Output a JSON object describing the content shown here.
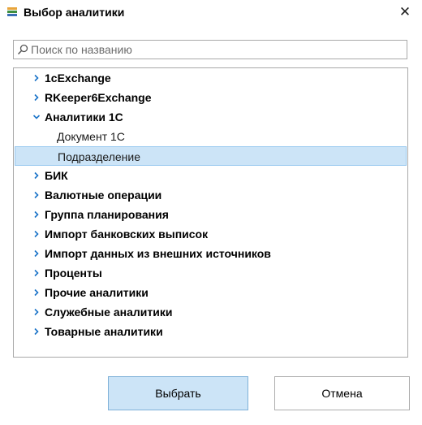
{
  "window": {
    "title": "Выбор аналитики",
    "close_glyph": "✕"
  },
  "search": {
    "placeholder": "Поиск по названию",
    "value": ""
  },
  "tree": {
    "items": [
      {
        "label": "1cExchange",
        "expanded": false
      },
      {
        "label": "RKeeper6Exchange",
        "expanded": false
      },
      {
        "label": "Аналитики 1С",
        "expanded": true,
        "children": [
          {
            "label": "Документ 1С",
            "selected": false
          },
          {
            "label": "Подразделение",
            "selected": true
          }
        ]
      },
      {
        "label": "БИК",
        "expanded": false
      },
      {
        "label": "Валютные операции",
        "expanded": false
      },
      {
        "label": "Группа планирования",
        "expanded": false
      },
      {
        "label": "Импорт банковских выписок",
        "expanded": false
      },
      {
        "label": "Импорт данных из внешних источников",
        "expanded": false
      },
      {
        "label": "Проценты",
        "expanded": false
      },
      {
        "label": "Прочие аналитики",
        "expanded": false
      },
      {
        "label": "Служебные аналитики",
        "expanded": false
      },
      {
        "label": "Товарные аналитики",
        "expanded": false
      }
    ]
  },
  "buttons": {
    "ok_label": "Выбрать",
    "cancel_label": "Отмена"
  },
  "colors": {
    "accent": "#1a73c8",
    "selection_bg": "#cce4f7",
    "selection_border": "#99c9ef"
  }
}
